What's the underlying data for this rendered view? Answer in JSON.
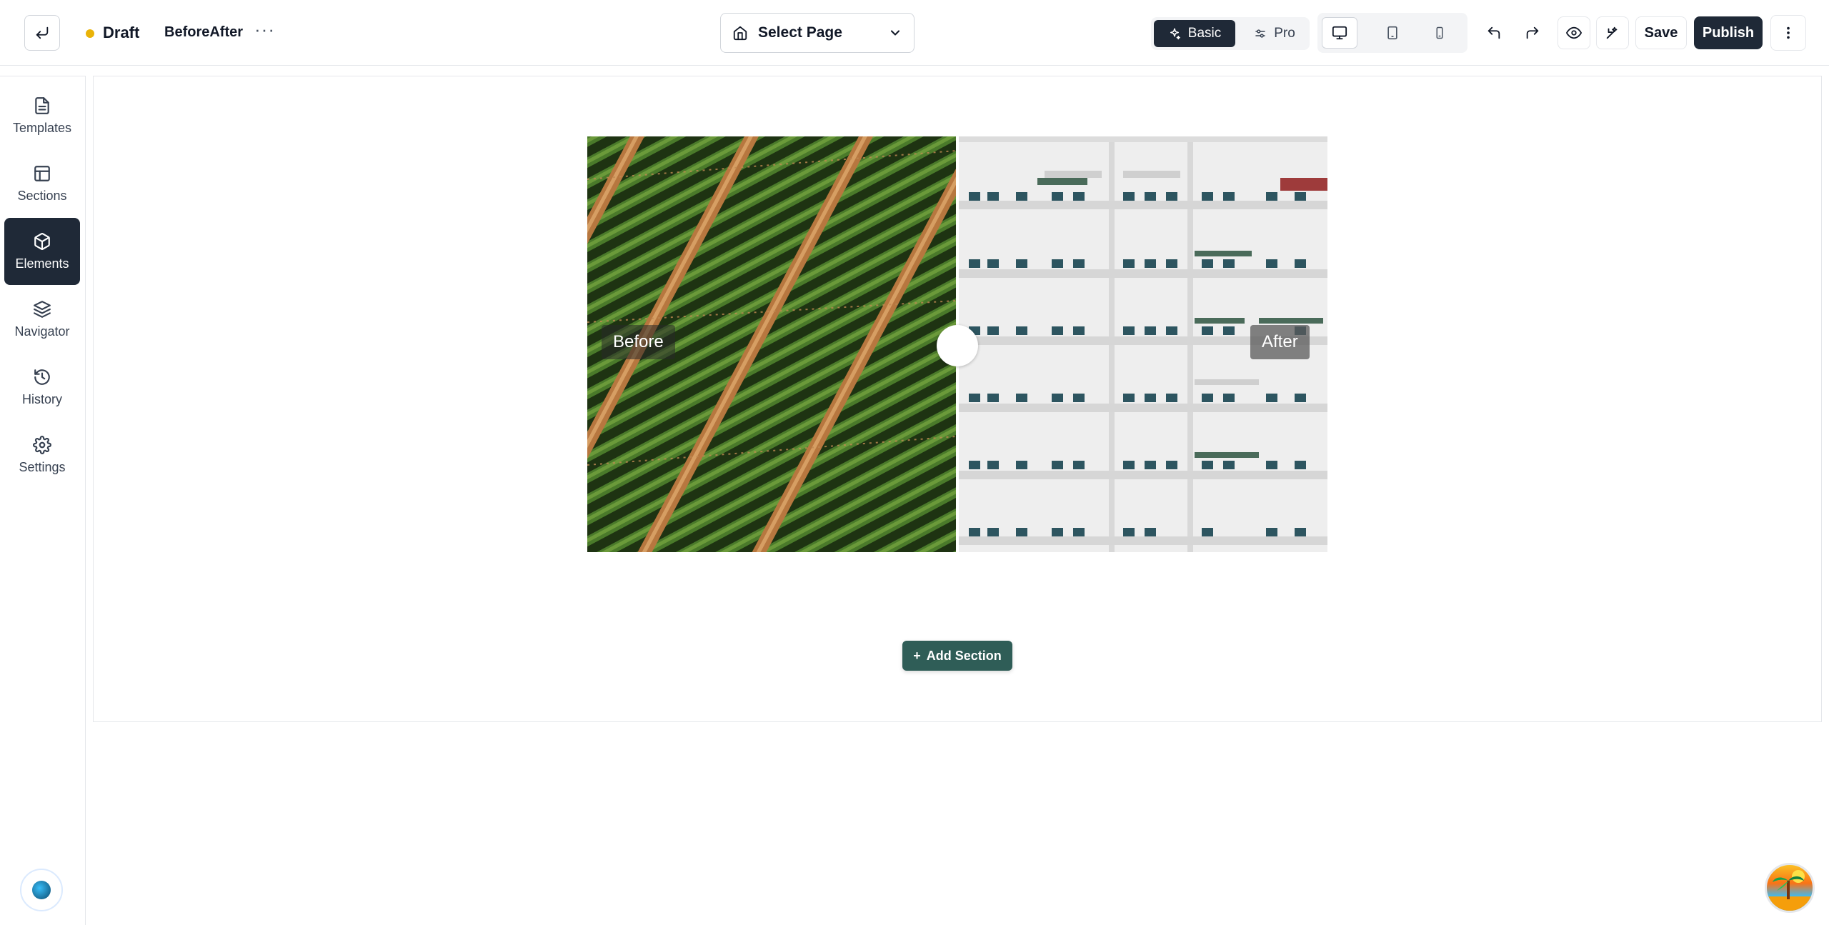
{
  "topbar": {
    "status": "Draft",
    "page_name": "BeforeAfter",
    "more_label": "···",
    "select_page": "Select Page",
    "mode_basic": "Basic",
    "mode_pro": "Pro",
    "save": "Save",
    "publish": "Publish",
    "status_color": "#eab308"
  },
  "sidebar": {
    "items": [
      {
        "label": "Templates",
        "icon": "file-text-icon"
      },
      {
        "label": "Sections",
        "icon": "layout-icon"
      },
      {
        "label": "Elements",
        "icon": "box-icon",
        "active": true
      },
      {
        "label": "Navigator",
        "icon": "layers-icon"
      },
      {
        "label": "History",
        "icon": "history-icon"
      },
      {
        "label": "Settings",
        "icon": "gear-icon"
      }
    ]
  },
  "canvas": {
    "before_label": "Before",
    "after_label": "After",
    "add_section": "Add Section",
    "add_section_icon": "+",
    "accent_color": "#2f5d57"
  }
}
